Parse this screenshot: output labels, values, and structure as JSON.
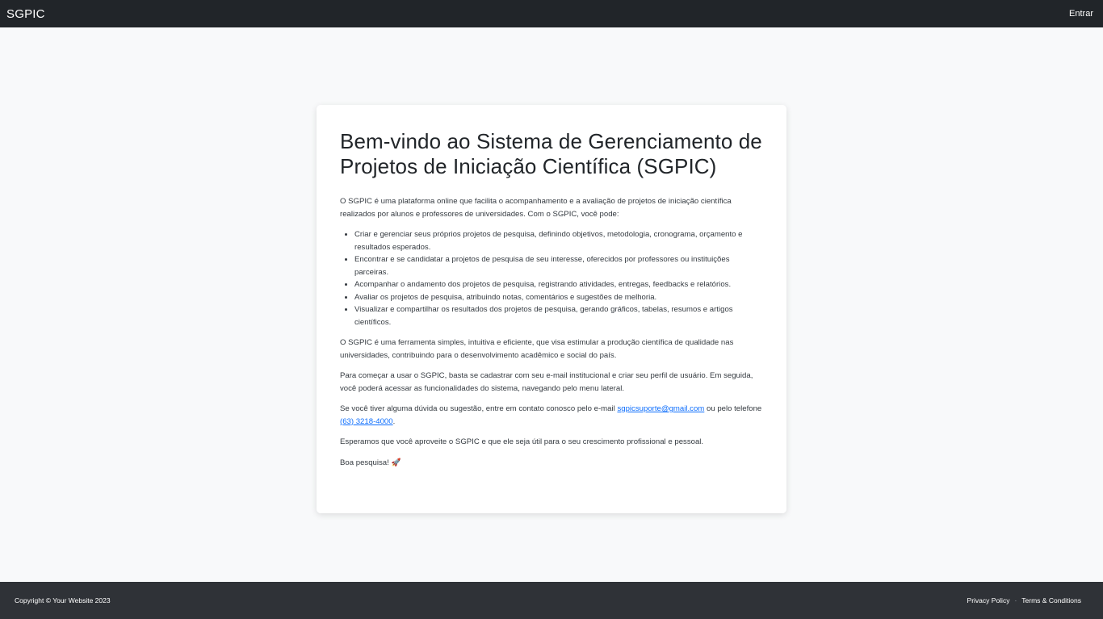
{
  "navbar": {
    "brand": "SGPIC",
    "login_label": "Entrar"
  },
  "content": {
    "title": "Bem-vindo ao Sistema de Gerenciamento de Projetos de Iniciação Científica (SGPIC)",
    "intro": "O SGPIC é uma plataforma online que facilita o acompanhamento e a avaliação de projetos de iniciação científica realizados por alunos e professores de universidades. Com o SGPIC, você pode:",
    "features": [
      "Criar e gerenciar seus próprios projetos de pesquisa, definindo objetivos, metodologia, cronograma, orçamento e resultados esperados.",
      "Encontrar e se candidatar a projetos de pesquisa de seu interesse, oferecidos por professores ou instituições parceiras.",
      "Acompanhar o andamento dos projetos de pesquisa, registrando atividades, entregas, feedbacks e relatórios.",
      "Avaliar os projetos de pesquisa, atribuindo notas, comentários e sugestões de melhoria.",
      "Visualizar e compartilhar os resultados dos projetos de pesquisa, gerando gráficos, tabelas, resumos e artigos científicos."
    ],
    "paragraph_tool": "O SGPIC é uma ferramenta simples, intuitiva e eficiente, que visa estimular a produção científica de qualidade nas universidades, contribuindo para o desenvolvimento acadêmico e social do país.",
    "paragraph_start": "Para começar a usar o SGPIC, basta se cadastrar com seu e-mail institucional e criar seu perfil de usuário. Em seguida, você poderá acessar as funcionalidades do sistema, navegando pelo menu lateral.",
    "contact": {
      "before_email": "Se você tiver alguma dúvida ou sugestão, entre em contato conosco pelo e-mail ",
      "email": "sgpicsuporte@gmail.com",
      "between": " ou pelo telefone ",
      "phone": "(63) 3218-4000",
      "after": "."
    },
    "paragraph_hope": "Esperamos que você aproveite o SGPIC e que ele seja útil para o seu crescimento profissional e pessoal.",
    "closing": "Boa pesquisa! 🚀"
  },
  "footer": {
    "copyright": "Copyright © Your Website 2023",
    "privacy_label": "Privacy Policy",
    "separator": "·",
    "terms_label": "Terms & Conditions"
  }
}
